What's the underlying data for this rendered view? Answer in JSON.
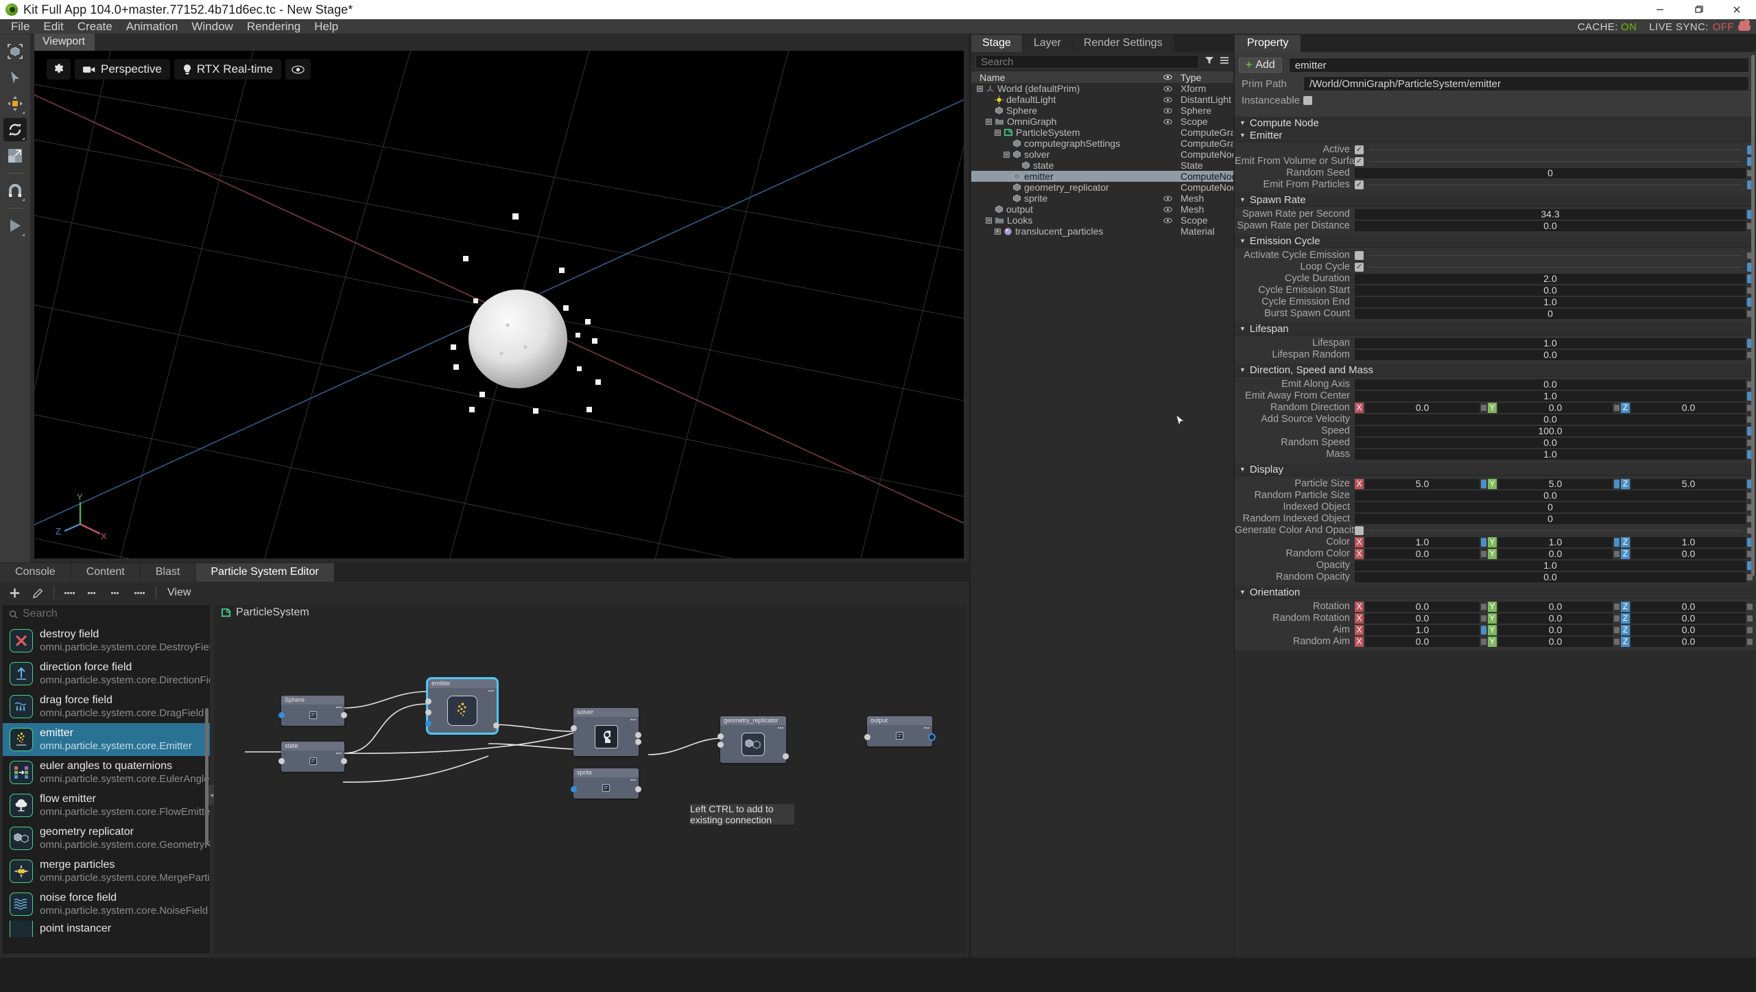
{
  "window": {
    "title": "Kit Full App 104.0+master.77152.4b71d6ec.tc - New Stage*",
    "minimize": "–",
    "maximize": "❐",
    "close": "✕"
  },
  "menubar": {
    "items": [
      "File",
      "Edit",
      "Create",
      "Animation",
      "Window",
      "Rendering",
      "Help"
    ],
    "cache_label": "CACHE:",
    "cache_value": "ON",
    "livesync_label": "LIVE SYNC:",
    "livesync_value": "OFF"
  },
  "left_toolbar": {
    "items": [
      {
        "name": "select-bbox-tool",
        "icon": "bounding-box-icon"
      },
      {
        "name": "select-tool",
        "icon": "arrow-cursor-icon"
      },
      {
        "name": "move-tool",
        "icon": "move-gizmo-icon"
      },
      {
        "name": "rotate-tool",
        "icon": "rotate-gizmo-icon",
        "active": true
      },
      {
        "name": "scale-tool",
        "icon": "scale-gizmo-icon"
      },
      {
        "name": "snap-tool",
        "icon": "magnet-icon"
      },
      {
        "name": "play-tool",
        "icon": "play-icon"
      }
    ]
  },
  "viewport": {
    "tab": "Viewport",
    "settings_label": "",
    "camera": "Perspective",
    "renderer": "RTX Real-time",
    "axis": {
      "x": "X",
      "y": "Y",
      "z": "Z"
    }
  },
  "bottom_dock": {
    "tabs": [
      {
        "label": "Console",
        "active": false
      },
      {
        "label": "Content",
        "active": false
      },
      {
        "label": "Blast",
        "active": false
      },
      {
        "label": "Particle System Editor",
        "active": true
      }
    ],
    "toolbar": {
      "view_label": "View"
    },
    "library": {
      "search_placeholder": "Search",
      "items": [
        {
          "name": "destroy field",
          "path": "omni.particle.system.core.DestroyField",
          "icon": "red-x-icon",
          "selected": false
        },
        {
          "name": "direction force field",
          "path": "omni.particle.system.core.DirectionField",
          "icon": "up-arrow-icon",
          "selected": false
        },
        {
          "name": "drag force field",
          "path": "omni.particle.system.core.DragField",
          "icon": "drag-arrows-icon",
          "selected": false
        },
        {
          "name": "emitter",
          "path": "omni.particle.system.core.Emitter",
          "icon": "emitter-particles-icon",
          "selected": true
        },
        {
          "name": "euler angles to quaternions",
          "path": "omni.particle.system.core.EulerAnglesToQu",
          "icon": "convert-blocks-icon",
          "selected": false
        },
        {
          "name": "flow emitter",
          "path": "omni.particle.system.core.FlowEmitter",
          "icon": "smoke-cloud-icon",
          "selected": false
        },
        {
          "name": "geometry replicator",
          "path": "omni.particle.system.core.GeometryReplica",
          "icon": "two-cubes-icon",
          "selected": false
        },
        {
          "name": "merge particles",
          "path": "omni.particle.system.core.MergeParticles",
          "icon": "merge-dots-icon",
          "selected": false
        },
        {
          "name": "noise force field",
          "path": "omni.particle.system.core.NoiseField",
          "icon": "waves-icon",
          "selected": false
        },
        {
          "name": "point instancer",
          "path": "",
          "icon": "point-instancer-icon",
          "selected": false
        }
      ]
    },
    "graph": {
      "title": "ParticleSystem",
      "hint": "Left CTRL to add to existing connection",
      "nodes": [
        {
          "label": "Sphere",
          "icon": "prim-icon",
          "selected": false
        },
        {
          "label": "state",
          "icon": "prim-icon",
          "selected": false
        },
        {
          "label": "emitter",
          "icon": "emitter-particles-icon",
          "selected": true
        },
        {
          "label": "solver",
          "icon": "brain-gears-icon",
          "selected": false
        },
        {
          "label": "sprite",
          "icon": "prim-icon",
          "selected": false
        },
        {
          "label": "geometry_replicator",
          "icon": "two-cubes-icon",
          "selected": false
        },
        {
          "label": "output",
          "icon": "prim-icon",
          "selected": false
        }
      ]
    }
  },
  "stage": {
    "tabs": [
      {
        "label": "Stage",
        "active": true
      },
      {
        "label": "Layer",
        "active": false
      },
      {
        "label": "Render Settings",
        "active": false
      }
    ],
    "search_placeholder": "Search",
    "columns": {
      "name": "Name",
      "eye": "eye-icon",
      "type": "Type"
    },
    "rows": [
      {
        "label": "World (defaultPrim)",
        "type": "Xform",
        "indent": 0,
        "expander": "minus",
        "icon": "xform-axis-icon",
        "eye": true,
        "selected": false
      },
      {
        "label": "defaultLight",
        "type": "DistantLight",
        "indent": 1,
        "expander": "",
        "icon": "light-icon",
        "eye": true,
        "selected": false
      },
      {
        "label": "Sphere",
        "type": "Sphere",
        "indent": 1,
        "expander": "",
        "icon": "mesh-cube-icon",
        "eye": true,
        "selected": false
      },
      {
        "label": "OmniGraph",
        "type": "Scope",
        "indent": 1,
        "expander": "minus",
        "icon": "folder-icon",
        "eye": true,
        "selected": false
      },
      {
        "label": "ParticleSystem",
        "type": "ComputeGraph",
        "indent": 2,
        "expander": "minus",
        "icon": "graph-icon",
        "eye": false,
        "selected": false
      },
      {
        "label": "computegraphSettings",
        "type": "ComputeGraphSe",
        "indent": 3,
        "expander": "",
        "icon": "mesh-cube-icon",
        "eye": false,
        "selected": false
      },
      {
        "label": "solver",
        "type": "ComputeNode",
        "indent": 3,
        "expander": "minus",
        "icon": "mesh-cube-icon",
        "eye": false,
        "selected": false
      },
      {
        "label": "state",
        "type": "State",
        "indent": 4,
        "expander": "",
        "icon": "mesh-cube-icon",
        "eye": false,
        "selected": false
      },
      {
        "label": "emitter",
        "type": "ComputeNode",
        "indent": 3,
        "expander": "",
        "icon": "mesh-cube-icon",
        "eye": false,
        "selected": true
      },
      {
        "label": "geometry_replicator",
        "type": "ComputeNode",
        "indent": 3,
        "expander": "",
        "icon": "mesh-cube-icon",
        "eye": false,
        "selected": false
      },
      {
        "label": "sprite",
        "type": "Mesh",
        "indent": 3,
        "expander": "",
        "icon": "mesh-cube-icon",
        "eye": true,
        "selected": false
      },
      {
        "label": "output",
        "type": "Mesh",
        "indent": 1,
        "expander": "",
        "icon": "mesh-cube-icon",
        "eye": true,
        "selected": false
      },
      {
        "label": "Looks",
        "type": "Scope",
        "indent": 1,
        "expander": "minus",
        "icon": "folder-icon",
        "eye": true,
        "selected": false
      },
      {
        "label": "translucent_particles",
        "type": "Material",
        "indent": 2,
        "expander": "plus",
        "icon": "material-sphere-icon",
        "eye": false,
        "selected": false
      }
    ]
  },
  "property": {
    "tab": "Property",
    "add_label": "Add",
    "name_value": "emitter",
    "prim_path_label": "Prim Path",
    "prim_path_value": "/World/OmniGraph/ParticleSystem/emitter",
    "instanceable_label": "Instanceable",
    "instanceable_checked": false,
    "compute_node_label": "Compute Node",
    "sections": [
      {
        "title": "Emitter",
        "rows": [
          {
            "label": "Active",
            "kind": "check",
            "checked": true,
            "mini": "blue"
          },
          {
            "label": "Emit From Volume or Surface",
            "kind": "check",
            "checked": true,
            "mini": "blue"
          },
          {
            "label": "Random Seed",
            "kind": "num",
            "value": "0",
            "mini": "grey"
          },
          {
            "label": "Emit From Particles",
            "kind": "check",
            "checked": true,
            "mini": "blue"
          }
        ]
      },
      {
        "title": "Spawn Rate",
        "rows": [
          {
            "label": "Spawn Rate per Second",
            "kind": "num",
            "value": "34.3",
            "mini": "blue"
          },
          {
            "label": "Spawn Rate per Distance",
            "kind": "num",
            "value": "0.0",
            "mini": "grey"
          }
        ]
      },
      {
        "title": "Emission Cycle",
        "rows": [
          {
            "label": "Activate Cycle Emission",
            "kind": "check",
            "checked": false,
            "mini": "grey"
          },
          {
            "label": "Loop Cycle",
            "kind": "check",
            "checked": true,
            "mini": "blue"
          },
          {
            "label": "Cycle Duration",
            "kind": "num",
            "value": "2.0",
            "mini": "blue"
          },
          {
            "label": "Cycle Emission Start",
            "kind": "num",
            "value": "0.0",
            "mini": "grey"
          },
          {
            "label": "Cycle Emission End",
            "kind": "num",
            "value": "1.0",
            "mini": "blue"
          },
          {
            "label": "Burst Spawn Count",
            "kind": "num",
            "value": "0",
            "mini": "grey"
          }
        ]
      },
      {
        "title": "Lifespan",
        "rows": [
          {
            "label": "Lifespan",
            "kind": "num",
            "value": "1.0",
            "mini": "blue"
          },
          {
            "label": "Lifespan Random",
            "kind": "num",
            "value": "0.0",
            "mini": "grey"
          }
        ]
      },
      {
        "title": "Direction, Speed and Mass",
        "rows": [
          {
            "label": "Emit Along Axis",
            "kind": "num",
            "value": "0.0",
            "mini": "grey"
          },
          {
            "label": "Emit Away From Center",
            "kind": "num",
            "value": "1.0",
            "mini": "blue"
          },
          {
            "label": "Random Direction",
            "kind": "vec3",
            "x": "0.0",
            "y": "0.0",
            "z": "0.0",
            "minis": [
              "grey",
              "grey",
              "grey"
            ]
          },
          {
            "label": "Add Source Velocity",
            "kind": "num",
            "value": "0.0",
            "mini": "grey"
          },
          {
            "label": "Speed",
            "kind": "num",
            "value": "100.0",
            "mini": "blue"
          },
          {
            "label": "Random Speed",
            "kind": "num",
            "value": "0.0",
            "mini": "grey"
          },
          {
            "label": "Mass",
            "kind": "num",
            "value": "1.0",
            "mini": "blue"
          }
        ]
      },
      {
        "title": "Display",
        "rows": [
          {
            "label": "Particle Size",
            "kind": "vec3",
            "x": "5.0",
            "y": "5.0",
            "z": "5.0",
            "minis": [
              "blue",
              "blue",
              "blue"
            ]
          },
          {
            "label": "Random Particle Size",
            "kind": "num",
            "value": "0.0",
            "mini": "grey"
          },
          {
            "label": "Indexed Object",
            "kind": "num",
            "value": "0",
            "mini": "grey"
          },
          {
            "label": "Random Indexed Object",
            "kind": "num",
            "value": "0",
            "mini": "grey"
          },
          {
            "label": "Generate Color And Opacity",
            "kind": "check",
            "checked": false,
            "mini": "grey"
          },
          {
            "label": "Color",
            "kind": "vec3",
            "x": "1.0",
            "y": "1.0",
            "z": "1.0",
            "minis": [
              "blue",
              "blue",
              "blue"
            ]
          },
          {
            "label": "Random Color",
            "kind": "vec3",
            "x": "0.0",
            "y": "0.0",
            "z": "0.0",
            "minis": [
              "grey",
              "grey",
              "grey"
            ]
          },
          {
            "label": "Opacity",
            "kind": "num",
            "value": "1.0",
            "mini": "blue"
          },
          {
            "label": "Random Opacity",
            "kind": "num",
            "value": "0.0",
            "mini": "grey"
          }
        ]
      },
      {
        "title": "Orientation",
        "rows": [
          {
            "label": "Rotation",
            "kind": "vec3",
            "x": "0.0",
            "y": "0.0",
            "z": "0.0",
            "minis": [
              "grey",
              "grey",
              "grey"
            ]
          },
          {
            "label": "Random Rotation",
            "kind": "vec3",
            "x": "0.0",
            "y": "0.0",
            "z": "0.0",
            "minis": [
              "grey",
              "grey",
              "grey"
            ]
          },
          {
            "label": "Aim",
            "kind": "vec3",
            "x": "1.0",
            "y": "0.0",
            "z": "0.0",
            "minis": [
              "blue",
              "grey",
              "grey"
            ]
          },
          {
            "label": "Random Aim",
            "kind": "vec3",
            "x": "0.0",
            "y": "0.0",
            "z": "0.0",
            "minis": [
              "grey",
              "grey",
              "grey"
            ]
          }
        ]
      }
    ]
  },
  "colors": {
    "accent_blue": "#4a8fc7",
    "selection_blue": "#2a7294",
    "axis_x": "#b8555a",
    "axis_y": "#7fb85e",
    "axis_z": "#4a8fc7",
    "nvidia_green": "#76b900",
    "node_green": "#4fd18b"
  }
}
